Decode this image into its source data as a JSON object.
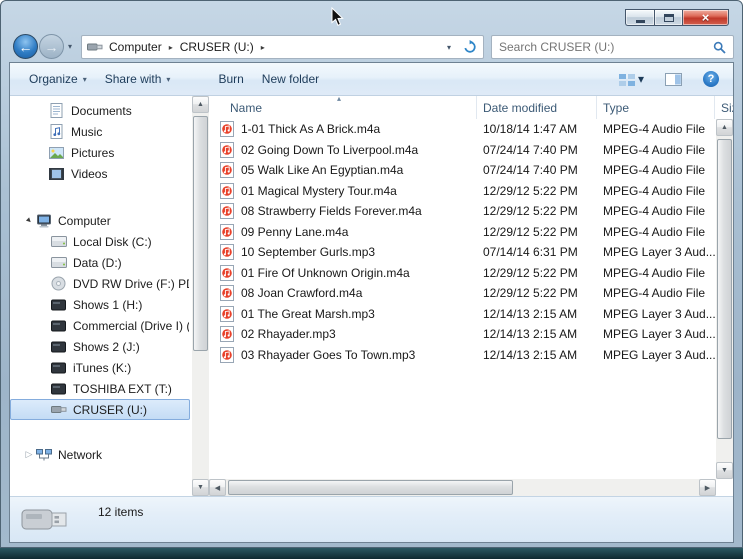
{
  "navigation": {
    "breadcrumb": {
      "root": "Computer",
      "current": "CRUSER (U:)"
    },
    "search_placeholder": "Search CRUSER (U:)"
  },
  "toolbar": {
    "organize_label": "Organize",
    "share_with_label": "Share with",
    "burn_label": "Burn",
    "new_folder_label": "New folder"
  },
  "sidebar": {
    "libraries": [
      {
        "label": "Documents",
        "icon": "documents-icon"
      },
      {
        "label": "Music",
        "icon": "music-icon"
      },
      {
        "label": "Pictures",
        "icon": "pictures-icon"
      },
      {
        "label": "Videos",
        "icon": "videos-icon"
      }
    ],
    "computer": {
      "label": "Computer",
      "icon": "computer-icon"
    },
    "drives": [
      {
        "label": "Local Disk (C:)",
        "icon": "hdd-icon"
      },
      {
        "label": "Data (D:)",
        "icon": "hdd-icon"
      },
      {
        "label": "DVD RW Drive (F:) PDT a",
        "icon": "dvd-icon"
      },
      {
        "label": "Shows 1 (H:)",
        "icon": "external-drive-icon"
      },
      {
        "label": "Commercial (Drive I) (I:)",
        "icon": "external-drive-icon"
      },
      {
        "label": "Shows 2 (J:)",
        "icon": "external-drive-icon"
      },
      {
        "label": "iTunes (K:)",
        "icon": "external-drive-icon"
      },
      {
        "label": "TOSHIBA EXT (T:)",
        "icon": "external-drive-icon"
      },
      {
        "label": "CRUSER (U:)",
        "icon": "usb-drive-icon",
        "selected": true
      }
    ],
    "network": {
      "label": "Network",
      "icon": "network-icon"
    }
  },
  "filelist": {
    "columns": [
      {
        "label": "Name"
      },
      {
        "label": "Date modified"
      },
      {
        "label": "Type"
      },
      {
        "label": "Size"
      }
    ],
    "rows": [
      {
        "name": "1-01 Thick As A Brick.m4a",
        "date_modified": "10/18/14 1:47 AM",
        "type": "MPEG-4 Audio File"
      },
      {
        "name": "02 Going Down To Liverpool.m4a",
        "date_modified": "07/24/14 7:40 PM",
        "type": "MPEG-4 Audio File"
      },
      {
        "name": "05 Walk Like An Egyptian.m4a",
        "date_modified": "07/24/14 7:40 PM",
        "type": "MPEG-4 Audio File"
      },
      {
        "name": "01 Magical Mystery Tour.m4a",
        "date_modified": "12/29/12 5:22 PM",
        "type": "MPEG-4 Audio File"
      },
      {
        "name": "08 Strawberry Fields Forever.m4a",
        "date_modified": "12/29/12 5:22 PM",
        "type": "MPEG-4 Audio File"
      },
      {
        "name": "09 Penny Lane.m4a",
        "date_modified": "12/29/12 5:22 PM",
        "type": "MPEG-4 Audio File"
      },
      {
        "name": "10 September Gurls.mp3",
        "date_modified": "07/14/14 6:31 PM",
        "type": "MPEG Layer 3 Aud..."
      },
      {
        "name": "01 Fire Of Unknown Origin.m4a",
        "date_modified": "12/29/12 5:22 PM",
        "type": "MPEG-4 Audio File"
      },
      {
        "name": "08 Joan Crawford.m4a",
        "date_modified": "12/29/12 5:22 PM",
        "type": "MPEG-4 Audio File"
      },
      {
        "name": "01 The Great Marsh.mp3",
        "date_modified": "12/14/13 2:15 AM",
        "type": "MPEG Layer 3 Aud..."
      },
      {
        "name": "02 Rhayader.mp3",
        "date_modified": "12/14/13 2:15 AM",
        "type": "MPEG Layer 3 Aud..."
      },
      {
        "name": "03 Rhayader Goes To Town.mp3",
        "date_modified": "12/14/13 2:15 AM",
        "type": "MPEG Layer 3 Aud..."
      }
    ]
  },
  "statusbar": {
    "items_count": "12 items"
  },
  "icons": {
    "close_glyph": "×",
    "back_arrow": "←",
    "forward_arrow": "→",
    "chevron_down": "▾",
    "breadcrumb_separator": "▸",
    "expander_expanded": "▸",
    "expander_collapsed": "▷",
    "sort_ascending": "▴",
    "scroll_up": "▲",
    "scroll_down": "▼",
    "scroll_left": "◀",
    "scroll_right": "▶",
    "help_glyph": "?"
  },
  "colors": {
    "selection_fill": "#cde3f7",
    "selection_border": "#84acdd",
    "close_button": "#c0392a",
    "audio_icon": "#e8402a",
    "frame": "#a9bfd2"
  }
}
